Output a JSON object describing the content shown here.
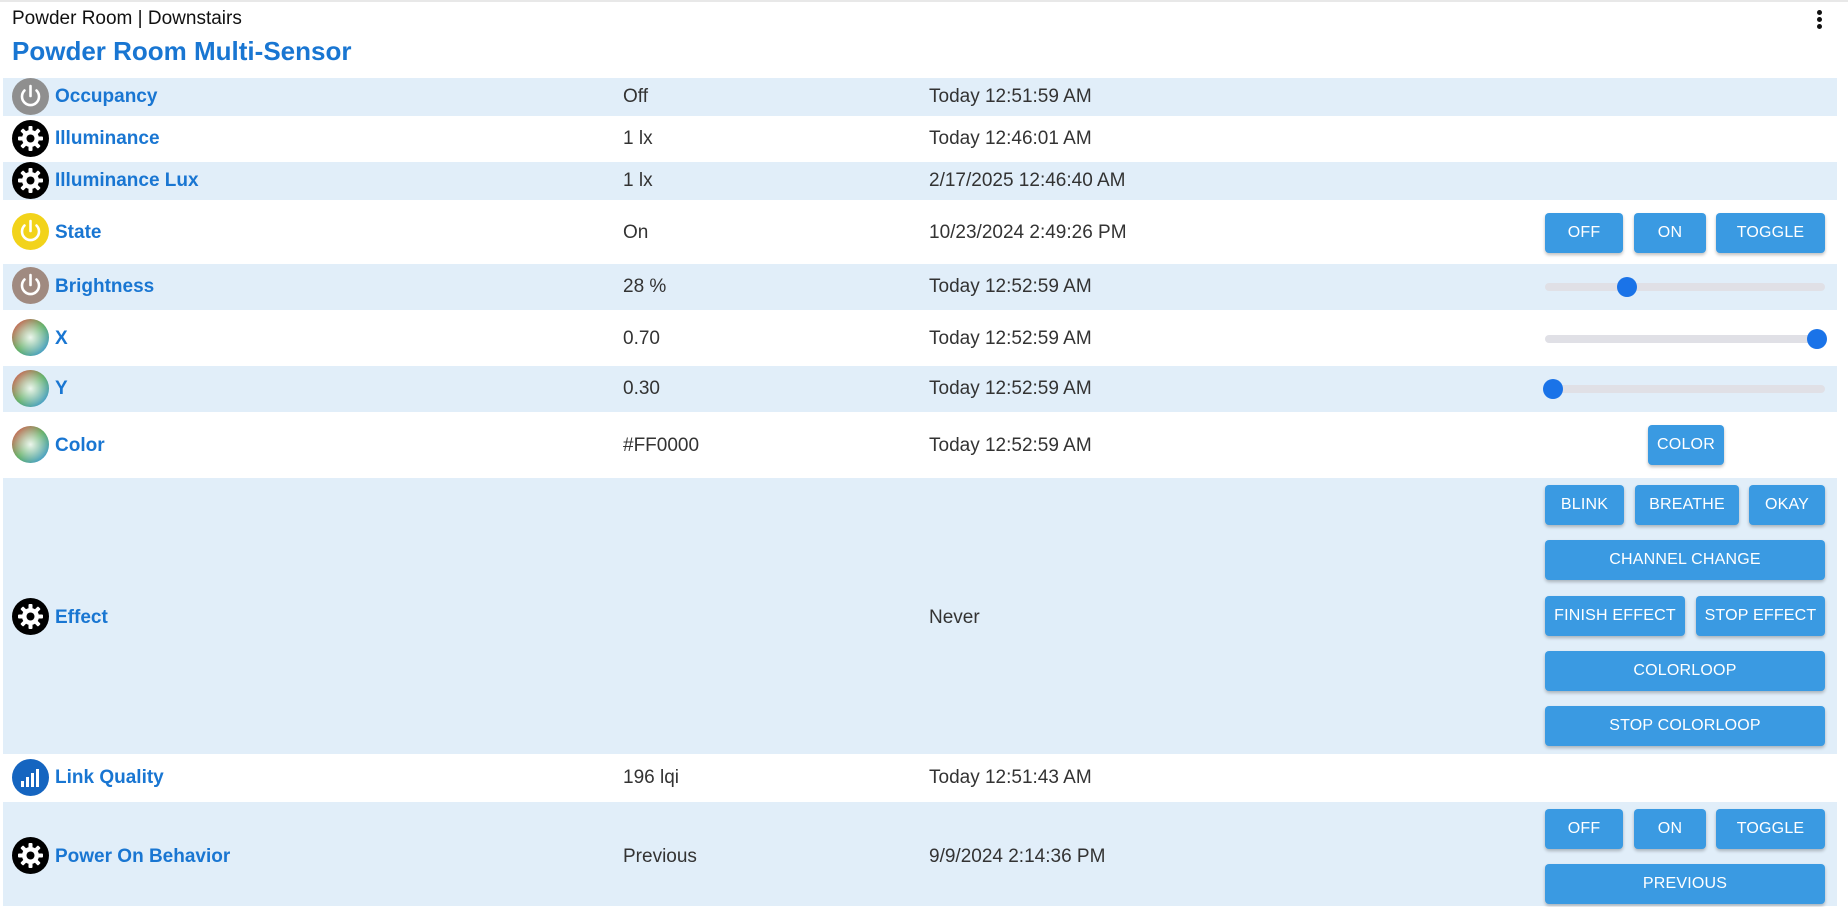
{
  "header": {
    "breadcrumb": "Powder Room | Downstairs",
    "title": "Powder Room Multi-Sensor"
  },
  "colors": {
    "accent": "#1976d2",
    "button": "#3a9ae2",
    "row_alt": "#e1eef9",
    "state_icon": "#f2d31a",
    "brightness_icon": "#a08a80",
    "occupancy_icon": "#8f8f8f"
  },
  "rows": [
    {
      "name": "Occupancy",
      "icon": "power-icon",
      "value": "Off",
      "time": "Today 12:51:59 AM"
    },
    {
      "name": "Illuminance",
      "icon": "gear-icon",
      "value": "1 lx",
      "time": "Today 12:46:01 AM"
    },
    {
      "name": "Illuminance Lux",
      "icon": "gear-icon",
      "value": "1 lx",
      "time": "2/17/2025 12:46:40 AM"
    },
    {
      "name": "State",
      "icon": "power-icon",
      "value": "On",
      "time": "10/23/2024 2:49:26 PM",
      "buttons": [
        "OFF",
        "ON",
        "TOGGLE"
      ]
    },
    {
      "name": "Brightness",
      "icon": "power-icon",
      "value": "28 %",
      "time": "Today 12:52:59 AM",
      "slider_level": 0.28
    },
    {
      "name": "X",
      "icon": "color-wheel-icon",
      "value": "0.70",
      "time": "Today 12:52:59 AM",
      "slider_level": 1.0
    },
    {
      "name": "Y",
      "icon": "color-wheel-icon",
      "value": "0.30",
      "time": "Today 12:52:59 AM",
      "slider_level": 0.0
    },
    {
      "name": "Color",
      "icon": "color-wheel-icon",
      "value": "#FF0000",
      "time": "Today 12:52:59 AM",
      "buttons": [
        "COLOR"
      ]
    },
    {
      "name": "Effect",
      "icon": "gear-icon",
      "value": "",
      "time": "Never",
      "buttons": [
        "BLINK",
        "BREATHE",
        "OKAY",
        "CHANNEL CHANGE",
        "FINISH EFFECT",
        "STOP EFFECT",
        "COLORLOOP",
        "STOP COLORLOOP"
      ]
    },
    {
      "name": "Link Quality",
      "icon": "signal-bars-icon",
      "value": "196 lqi",
      "time": "Today 12:51:43 AM"
    },
    {
      "name": "Power On Behavior",
      "icon": "gear-icon",
      "value": "Previous",
      "time": "9/9/2024 2:14:36 PM",
      "buttons": [
        "OFF",
        "ON",
        "TOGGLE",
        "PREVIOUS"
      ]
    }
  ]
}
